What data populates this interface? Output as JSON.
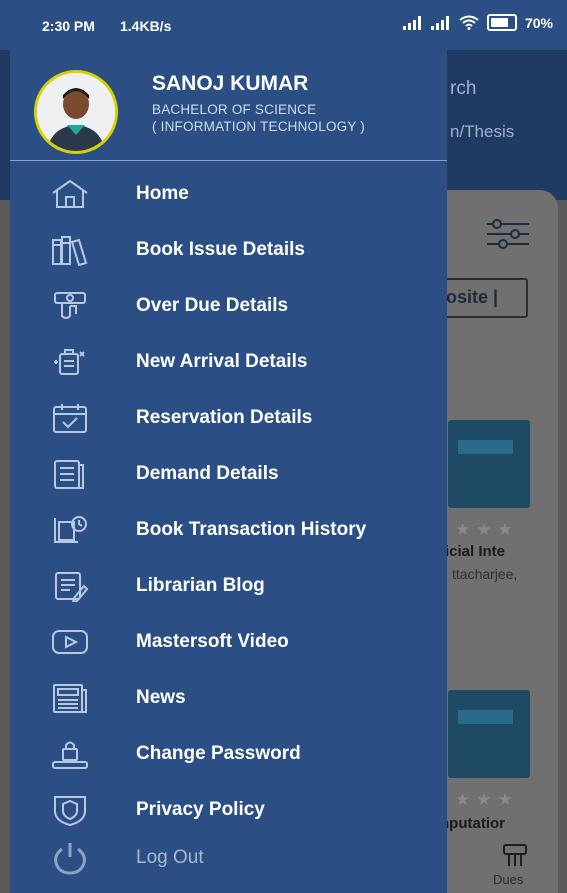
{
  "status_bar": {
    "time": "2:30 PM",
    "speed": "1.4KB/s",
    "battery": "70%"
  },
  "user": {
    "name": "SANOJ KUMAR",
    "degree_line1": "BACHELOR OF SCIENCE",
    "degree_line2": "( INFORMATION TECHNOLOGY )"
  },
  "menu": [
    {
      "label": "Home",
      "icon": "home-icon"
    },
    {
      "label": "Book Issue Details",
      "icon": "books-icon"
    },
    {
      "label": "Over Due Details",
      "icon": "overdue-icon"
    },
    {
      "label": "New Arrival Details",
      "icon": "new-arrival-icon"
    },
    {
      "label": "Reservation Details",
      "icon": "calendar-check-icon"
    },
    {
      "label": "Demand Details",
      "icon": "demand-list-icon"
    },
    {
      "label": "Book Transaction History",
      "icon": "transaction-history-icon"
    },
    {
      "label": "Librarian Blog",
      "icon": "blog-icon"
    },
    {
      "label": "Mastersoft Video",
      "icon": "video-play-icon"
    },
    {
      "label": "News",
      "icon": "newspaper-icon"
    },
    {
      "label": "Change Password",
      "icon": "lock-icon"
    },
    {
      "label": "Privacy Policy",
      "icon": "shield-icon"
    },
    {
      "label": "Log Out",
      "icon": "power-icon"
    }
  ],
  "background": {
    "search_partial": "rch",
    "thesis_partial": "n/Thesis",
    "site_button_partial": "osite |",
    "book1_title_partial": "ficial Inte",
    "book1_author_partial": "ttacharjee,",
    "book2_title_partial": "nputatior",
    "dues_label": "Dues"
  },
  "colors": {
    "drawer": "#2b4f85",
    "header": "#1f3b63",
    "avatar_border": "#d9d200"
  }
}
